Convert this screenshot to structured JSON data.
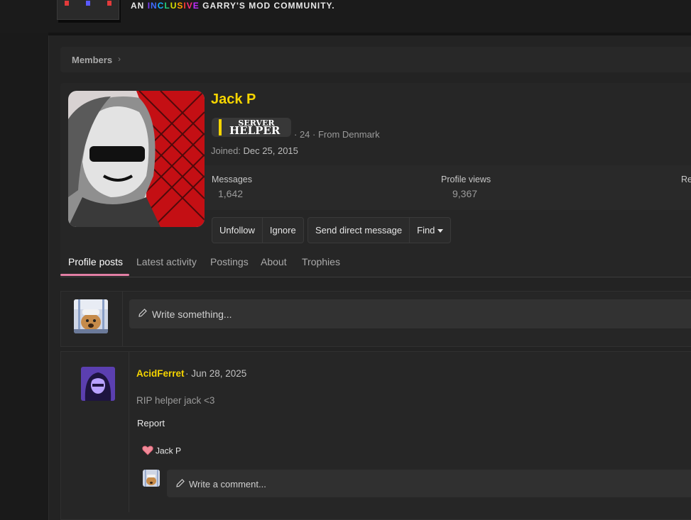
{
  "header": {
    "tagline_prefix": "AN",
    "tagline_highlight": "INCLUSIVE",
    "tagline_suffix": "GARRY'S MOD COMMUNITY.",
    "rainbow_colors": [
      "#7b3cff",
      "#3f6bff",
      "#19b3ff",
      "#22d07a",
      "#d8e000",
      "#ffa000",
      "#ff3b30",
      "#ff2d7a",
      "#c02dff"
    ]
  },
  "breadcrumb": {
    "label": "Members"
  },
  "profile": {
    "name": "Jack P",
    "badge_line1": "SERVER",
    "badge_line2": "HELPER",
    "meta": "· 24 · From Denmark",
    "joined_label": "Joined:",
    "joined_date": "Dec 25, 2015",
    "stats": [
      {
        "label": "Messages",
        "value": "1,642"
      },
      {
        "label": "Profile views",
        "value": "9,367"
      },
      {
        "label": "Re",
        "value": ""
      }
    ],
    "buttons": {
      "unfollow": "Unfollow",
      "ignore": "Ignore",
      "send_dm": "Send direct message",
      "find": "Find"
    }
  },
  "tabs": [
    {
      "label": "Profile posts",
      "active": true
    },
    {
      "label": "Latest activity",
      "active": false
    },
    {
      "label": "Postings",
      "active": false
    },
    {
      "label": "About",
      "active": false
    },
    {
      "label": "Trophies",
      "active": false
    }
  ],
  "composer": {
    "placeholder": "Write something..."
  },
  "post": {
    "author": "AcidFerret",
    "date": "· Jun 28, 2025",
    "body": "RIP helper jack <3",
    "report_label": "Report",
    "reaction_user": "Jack P",
    "comment_placeholder": "Write a comment..."
  },
  "colors": {
    "accent_yellow": "#f5d400",
    "tab_underline": "#e27fa4",
    "page_bg": "#232323"
  },
  "icons": [
    "pencil-icon",
    "heart-icon",
    "caret-down-icon",
    "chevron-right-icon"
  ]
}
